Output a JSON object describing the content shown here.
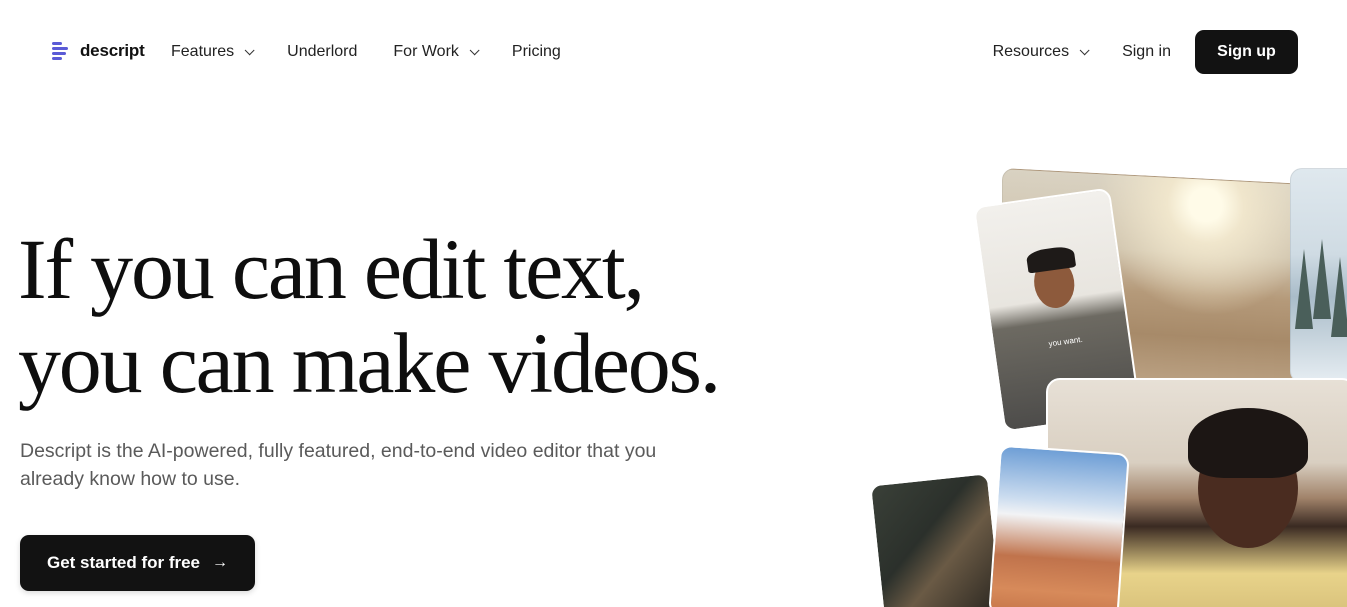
{
  "brand": {
    "name": "descript",
    "logo_icon": "descript-logo-icon",
    "accent": "#5b5bd6"
  },
  "nav": {
    "left": [
      {
        "label": "Features",
        "dropdown": true
      },
      {
        "label": "Underlord",
        "dropdown": false
      },
      {
        "label": "For Work",
        "dropdown": true
      },
      {
        "label": "Pricing",
        "dropdown": false
      }
    ],
    "resources": "Resources",
    "sign_in": "Sign in",
    "sign_up": "Sign up"
  },
  "hero": {
    "headline_line1": "If you can edit text,",
    "headline_line2": "you can make videos.",
    "subcopy": "Descript is the AI-powered, fully featured, end-to-end video editor that you already know how to use.",
    "cta": "Get started for free",
    "cta_icon": "arrow-right-icon"
  },
  "collage": {
    "overlay_caption": "you want."
  }
}
